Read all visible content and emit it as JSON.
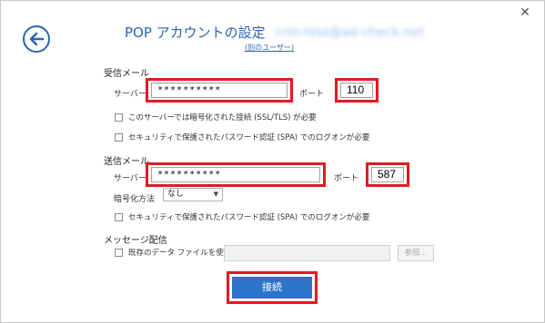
{
  "header": {
    "title": "POP アカウントの設定",
    "email": "crm-test@ad-check.net",
    "other_user_link": "(別のユーザー)"
  },
  "incoming": {
    "section_label": "受信メール",
    "server_label": "サーバー",
    "server_value": "**********",
    "port_label": "ポート",
    "port_value": "110",
    "ssl_checkbox_label": "このサーバーでは暗号化された接続 (SSL/TLS) が必要",
    "spa_checkbox_label": "セキュリティで保護されたパスワード認証 (SPA) でのログオンが必要"
  },
  "outgoing": {
    "section_label": "送信メール",
    "server_label": "サーバー",
    "server_value": "**********",
    "port_label": "ポート",
    "port_value": "587",
    "encryption_label": "暗号化方法",
    "encryption_value": "なし",
    "spa_checkbox_label": "セキュリティで保護されたパスワード認証 (SPA) でのログオンが必要"
  },
  "delivery": {
    "section_label": "メッセージ配信",
    "existing_file_label": "既存のデータ ファイルを使用",
    "browse_label": "参照..."
  },
  "footer": {
    "connect_label": "接続"
  },
  "icons": {
    "close": "close-icon",
    "back": "back-arrow-icon",
    "dropdown": "chevron-down-icon"
  },
  "colors": {
    "accent": "#2b64b6",
    "button": "#2b74c8",
    "highlight": "#e21a22"
  }
}
